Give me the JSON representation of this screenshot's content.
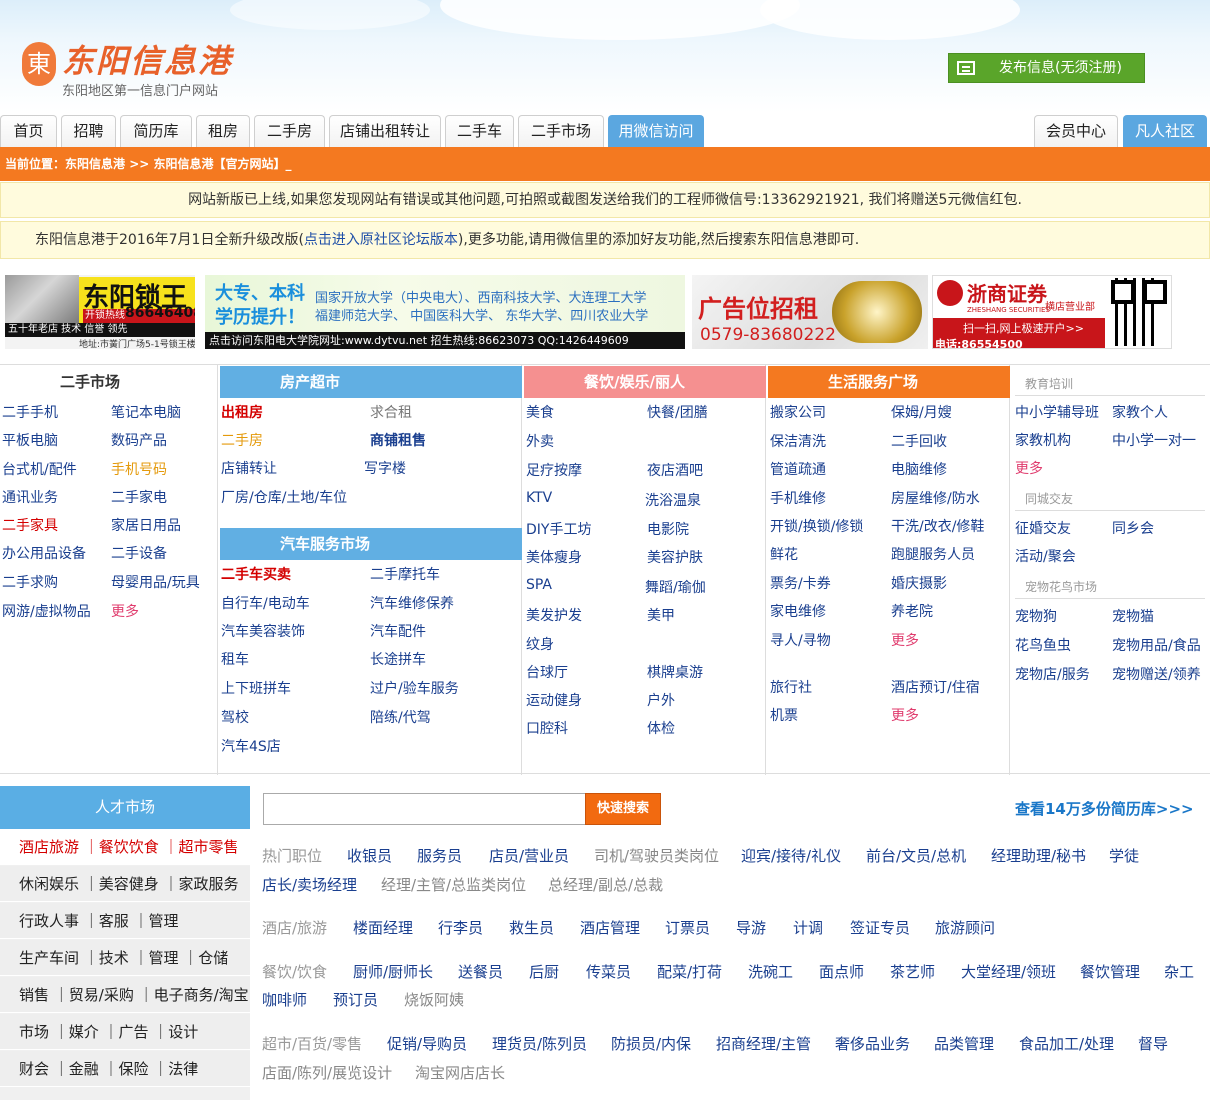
{
  "header": {
    "logo_mark": "東",
    "title": "东阳信息港",
    "subtitle": "东阳地区第一信息门户网站",
    "post_button": "发布信息(无须注册)"
  },
  "nav": {
    "tabs": [
      "首页",
      "招聘",
      "简历库",
      "租房",
      "二手房",
      "店铺出租转让",
      "二手车",
      "二手市场",
      "用微信访问"
    ],
    "member": "会员中心",
    "community": "凡人社区"
  },
  "breadcrumb": {
    "label": "当前位置：",
    "path": "东阳信息港 >> 东阳信息港【官方网站】_"
  },
  "notices": {
    "n1": "网站新版已上线,如果您发现网站有错误或其他问题,可拍照或截图发送给我们的工程师微信号:13362921921, 我们将赠送5元微信红包.",
    "n2_pre": "东阳信息港于2016年7月1日全新升级改版(",
    "n2_link": "点击进入原社区论坛版本",
    "n2_post": "),更多功能,请用微信里的添加好友功能,然后搜索东阳信息港即可."
  },
  "banners": {
    "lock": {
      "title": "东阳锁王",
      "hotline": "开锁热线",
      "phone": "86646408",
      "bar": "五十年老店  技术 信誉 领先",
      "addr": "地址:市黉门广场5-1号锁王楼"
    },
    "edu": {
      "h1": "大专、本科",
      "h2": "学历提升！",
      "line1": "国家开放大学（中央电大）、西南科技大学、大连理工大学",
      "line2": "福建师范大学、  中国医科大学、  东华大学、四川农业大学",
      "foot": "点击访问东阳电大学院网址:www.dytvu.net   招生热线:86623073   QQ:1426449609"
    },
    "ad": {
      "title": "广告位招租",
      "phone": "0579-83680222"
    },
    "sec": {
      "name": "浙商证券",
      "branch": "横店营业部",
      "en": "ZHESHANG SECURITIES",
      "scan": "扫一扫,网上极速开户>>",
      "tel": "电话:86554500"
    }
  },
  "categories": {
    "secondhand": {
      "title": "二手市场",
      "left": [
        "二手手机",
        "平板电脑",
        "台式机/配件",
        "通讯业务",
        "二手家具",
        "办公用品设备",
        "二手求购",
        "网游/虚拟物品"
      ],
      "right": [
        "笔记本电脑",
        "数码产品",
        "手机号码",
        "二手家电",
        "家居日用品",
        "二手设备",
        "母婴用品/玩具",
        "更多"
      ]
    },
    "house": {
      "title": "房产超市",
      "items": [
        "出租房",
        "求合租",
        "二手房",
        "商铺租售",
        "店铺转让",
        "写字楼",
        "厂房/仓库/土地/车位"
      ]
    },
    "car": {
      "title": "汽车服务市场",
      "left": [
        "二手车买卖",
        "自行车/电动车",
        "汽车美容装饰",
        "租车",
        "上下班拼车",
        "驾校",
        "汽车4S店"
      ],
      "right": [
        "二手摩托车",
        "汽车维修保养",
        "汽车配件",
        "长途拼车",
        "过户/验车服务",
        "陪练/代驾"
      ]
    },
    "food": {
      "title": "餐饮/娱乐/丽人",
      "left": [
        "美食",
        "外卖",
        "足疗按摩",
        "KTV",
        "DIY手工坊",
        "美体瘦身",
        "SPA",
        "美发护发",
        "纹身",
        "台球厅",
        "运动健身",
        "口腔科"
      ],
      "right": [
        "快餐/团膳",
        "夜店酒吧",
        "洗浴温泉",
        "电影院",
        "美容护肤",
        "舞蹈/瑜伽",
        "美甲",
        "棋牌桌游",
        "户外",
        "体检"
      ]
    },
    "life": {
      "title": "生活服务广场",
      "left": [
        "搬家公司",
        "保洁清洗",
        "管道疏通",
        "手机维修",
        "开锁/换锁/修锁",
        "鲜花",
        "票务/卡券",
        "家电维修",
        "寻人/寻物",
        "旅行社",
        "机票"
      ],
      "right": [
        "保姆/月嫂",
        "二手回收",
        "电脑维修",
        "房屋维修/防水",
        "干洗/改衣/修鞋",
        "跑腿服务人员",
        "婚庆摄影",
        "养老院",
        "更多",
        "酒店预订/住宿",
        "更多"
      ]
    },
    "edu": {
      "title": "教育培训",
      "items": [
        "中小学辅导班",
        "家教个人",
        "家教机构",
        "中小学一对一",
        "更多"
      ],
      "dating_title": "同城交友",
      "dating": [
        "征婚交友",
        "同乡会",
        "活动/聚会"
      ],
      "pet_title": "宠物花鸟市场",
      "pets": [
        "宠物狗",
        "宠物猫",
        "花鸟鱼虫",
        "宠物用品/食品",
        "宠物店/服务",
        "宠物赠送/领养"
      ]
    }
  },
  "talent": {
    "title": "人才市场",
    "side": [
      "酒店旅游 ｜餐饮饮食 ｜超市零售",
      "休闲娱乐 ｜美容健身 ｜家政服务",
      "行政人事 ｜客服 ｜管理",
      "生产车间 ｜技术 ｜管理 ｜仓储",
      "销售 ｜贸易/采购 ｜电子商务/淘宝",
      "市场 ｜媒介 ｜广告 ｜设计",
      "财会 ｜金融 ｜保险 ｜法律"
    ],
    "search_button": "快速搜索",
    "resume_link": "查看14万多份简历库>>>",
    "groups": [
      {
        "label": "热门职位",
        "row1": [
          "收银员",
          "服务员",
          "店员/营业员",
          "司机/驾驶员类岗位",
          "迎宾/接待/礼仪",
          "前台/文员/总机",
          "经理助理/秘书",
          "学徒"
        ],
        "row2": [
          "店长/卖场经理",
          "经理/主管/总监类岗位",
          "总经理/副总/总裁"
        ]
      },
      {
        "label": "酒店/旅游",
        "row1": [
          "楼面经理",
          "行李员",
          "救生员",
          "酒店管理",
          "订票员",
          "导游",
          "计调",
          "签证专员",
          "旅游顾问"
        ]
      },
      {
        "label": "餐饮/饮食",
        "row1": [
          "厨师/厨师长",
          "送餐员",
          "后厨",
          "传菜员",
          "配菜/打荷",
          "洗碗工",
          "面点师",
          "茶艺师",
          "大堂经理/领班",
          "餐饮管理",
          "杂工"
        ],
        "row2": [
          "咖啡师",
          "预订员",
          "烧饭阿姨"
        ]
      },
      {
        "label": "超市/百货/零售",
        "row1": [
          "促销/导购员",
          "理货员/陈列员",
          "防损员/内保",
          "招商经理/主管",
          "奢侈品业务",
          "品类管理",
          "食品加工/处理",
          "督导"
        ],
        "row2": [
          "店面/陈列/展览设计",
          "淘宝网店店长"
        ]
      }
    ]
  },
  "colors": {
    "orange": "#f47920",
    "blue": "#5ba7e0",
    "pink": "#f59090",
    "green": "#5aa52a",
    "red": "#d40000"
  }
}
